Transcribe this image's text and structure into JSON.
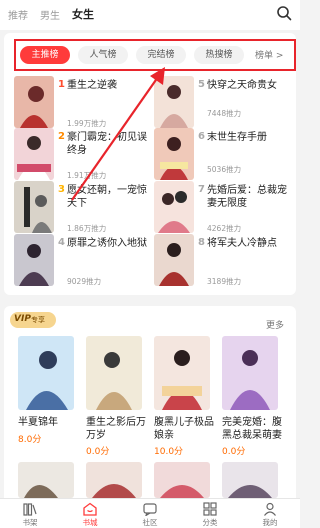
{
  "top_tabs": [
    {
      "label": "推荐",
      "active": false
    },
    {
      "label": "男生",
      "active": false
    },
    {
      "label": "女生",
      "active": true
    }
  ],
  "rank_tabs": [
    {
      "label": "主推榜",
      "active": true
    },
    {
      "label": "人气榜",
      "active": false
    },
    {
      "label": "完结榜",
      "active": false
    },
    {
      "label": "热搜榜",
      "active": false
    }
  ],
  "rank_more": "榜单 >",
  "rank_books": [
    {
      "rank": "1",
      "title": "重生之逆袭",
      "popularity": "1.99万推力",
      "rank_color": "#ff4d2e",
      "cover_color": "#e8b7a8"
    },
    {
      "rank": "2",
      "title": "豪门霸宠：初见误终身",
      "popularity": "1.91万推力",
      "rank_color": "#ff8a00",
      "cover_color": "#f2d4d8"
    },
    {
      "rank": "3",
      "title": "愿女还朝，一宠惊天下",
      "popularity": "1.86万推力",
      "rank_color": "#ffb400",
      "cover_color": "#d9d3c9"
    },
    {
      "rank": "4",
      "title": "原罪之诱你入地狱",
      "popularity": "9029推力",
      "rank_color": "#aaaaaa",
      "cover_color": "#c9c7cf"
    },
    {
      "rank": "5",
      "title": "快穿之天命贵女",
      "popularity": "7448推力",
      "rank_color": "#aaaaaa",
      "cover_color": "#f3e2d8"
    },
    {
      "rank": "6",
      "title": "末世生存手册",
      "popularity": "5036推力",
      "rank_color": "#aaaaaa",
      "cover_color": "#f0c9b9"
    },
    {
      "rank": "7",
      "title": "先婚后爱：总裁宠妻无限度",
      "popularity": "4262推力",
      "rank_color": "#aaaaaa",
      "cover_color": "#f6e3dd"
    },
    {
      "rank": "8",
      "title": "将军夫人冷静点",
      "popularity": "3189推力",
      "rank_color": "#aaaaaa",
      "cover_color": "#ead8cf"
    }
  ],
  "vip_section": {
    "badge": "VIP",
    "badge_sub": "专享",
    "more": "更多",
    "books": [
      {
        "title": "半夏锦年",
        "score": "8.0分",
        "cover_color": "#cfe6f6"
      },
      {
        "title": "重生之影后万万岁",
        "score": "0.0分",
        "cover_color": "#f1ead9"
      },
      {
        "title": "腹黑儿子极品娘亲",
        "score": "10.0分",
        "cover_color": "#f4e6df"
      },
      {
        "title": "完美宠婚：腹黑总裁呆萌妻",
        "score": "0.0分",
        "cover_color": "#e6d4ee"
      }
    ]
  },
  "bottom_nav": [
    {
      "label": "书架",
      "active": false
    },
    {
      "label": "书城",
      "active": true
    },
    {
      "label": "社区",
      "active": false
    },
    {
      "label": "分类",
      "active": false
    },
    {
      "label": "我的",
      "active": false
    }
  ],
  "colors": {
    "accent": "#ff3b3b",
    "annotation": "#e8242b",
    "score": "#ff6a00"
  }
}
